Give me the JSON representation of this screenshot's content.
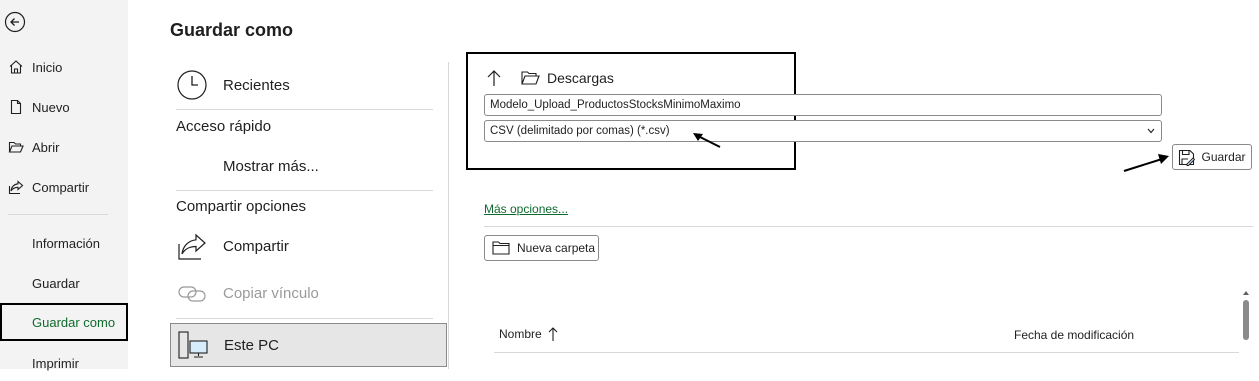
{
  "nav": {
    "items": [
      {
        "label": "Inicio",
        "icon": "home-icon"
      },
      {
        "label": "Nuevo",
        "icon": "new-document-icon"
      },
      {
        "label": "Abrir",
        "icon": "open-folder-icon"
      },
      {
        "label": "Compartir",
        "icon": "share-icon"
      },
      {
        "label": "Información"
      },
      {
        "label": "Guardar"
      },
      {
        "label": "Guardar como",
        "selected": true
      },
      {
        "label": "Imprimir"
      }
    ]
  },
  "page_title": "Guardar como",
  "places": {
    "recent": "Recientes",
    "quick_access": "Acceso rápido",
    "show_more": "Mostrar más...",
    "share_options": "Compartir opciones",
    "share": "Compartir",
    "copy_link": "Copiar vínculo",
    "this_pc": "Este PC"
  },
  "save_panel": {
    "current_folder": "Descargas",
    "file_name": "Modelo_Upload_ProductosStocksMinimoMaximo",
    "file_type": "CSV (delimitado por comas) (*.csv)",
    "save_label": "Guardar",
    "more_options": "Más opciones...",
    "new_folder": "Nueva carpeta",
    "columns": {
      "name": "Nombre",
      "modified": "Fecha de modificación"
    }
  },
  "colors": {
    "accent": "#0f6a2e",
    "nav_bg": "#f3f3f3"
  }
}
